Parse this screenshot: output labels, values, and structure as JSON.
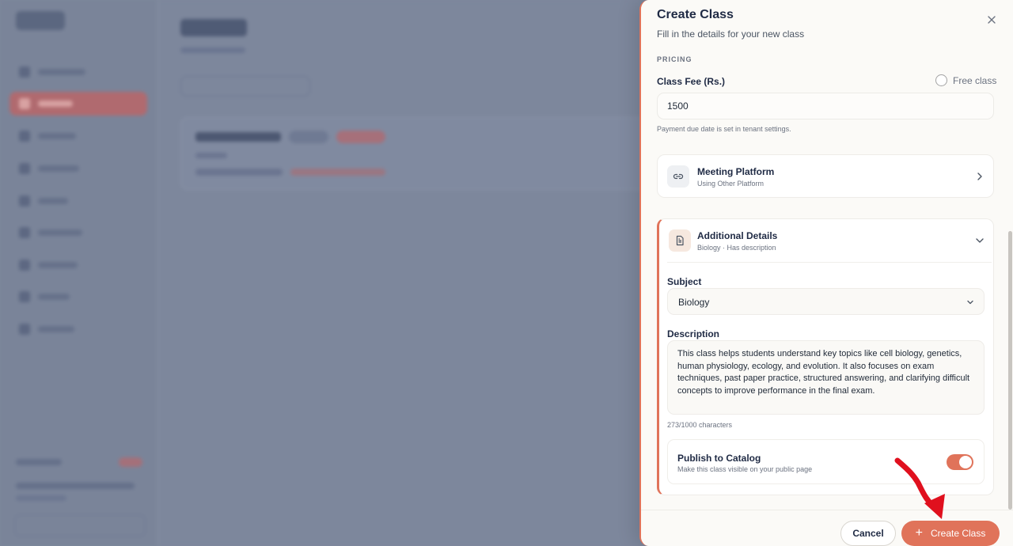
{
  "drawer": {
    "title": "Create Class",
    "subtitle": "Fill in the details for your new class"
  },
  "pricing": {
    "section_label": "PRICING",
    "fee_label": "Class Fee (Rs.)",
    "free_class_label": "Free class",
    "free_class_checked": false,
    "fee_value": "1500",
    "fee_hint": "Payment due date is set in tenant settings."
  },
  "meeting_platform": {
    "title": "Meeting Platform",
    "subtitle": "Using Other Platform"
  },
  "additional_details": {
    "title": "Additional Details",
    "subtitle": "Biology · Has description",
    "subject_label": "Subject",
    "subject_value": "Biology",
    "description_label": "Description",
    "description_value": "This class helps students understand key topics like cell biology, genetics, human physiology, ecology, and evolution. It also focuses on exam techniques, past paper practice, structured answering, and clarifying difficult concepts to improve performance in the final exam.",
    "char_count": "273/1000 characters",
    "publish_title": "Publish to Catalog",
    "publish_subtitle": "Make this class visible on your public page",
    "publish_enabled": true
  },
  "footer": {
    "cancel_label": "Cancel",
    "create_label": "Create Class"
  },
  "colors": {
    "accent": "#e0735a",
    "annotation_arrow": "#e0101e"
  },
  "icons": {
    "close": "close-icon",
    "link": "link-icon",
    "document": "document-icon",
    "chevron_right": "chevron-right-icon",
    "chevron_down": "chevron-down-icon",
    "plus": "plus-icon"
  }
}
